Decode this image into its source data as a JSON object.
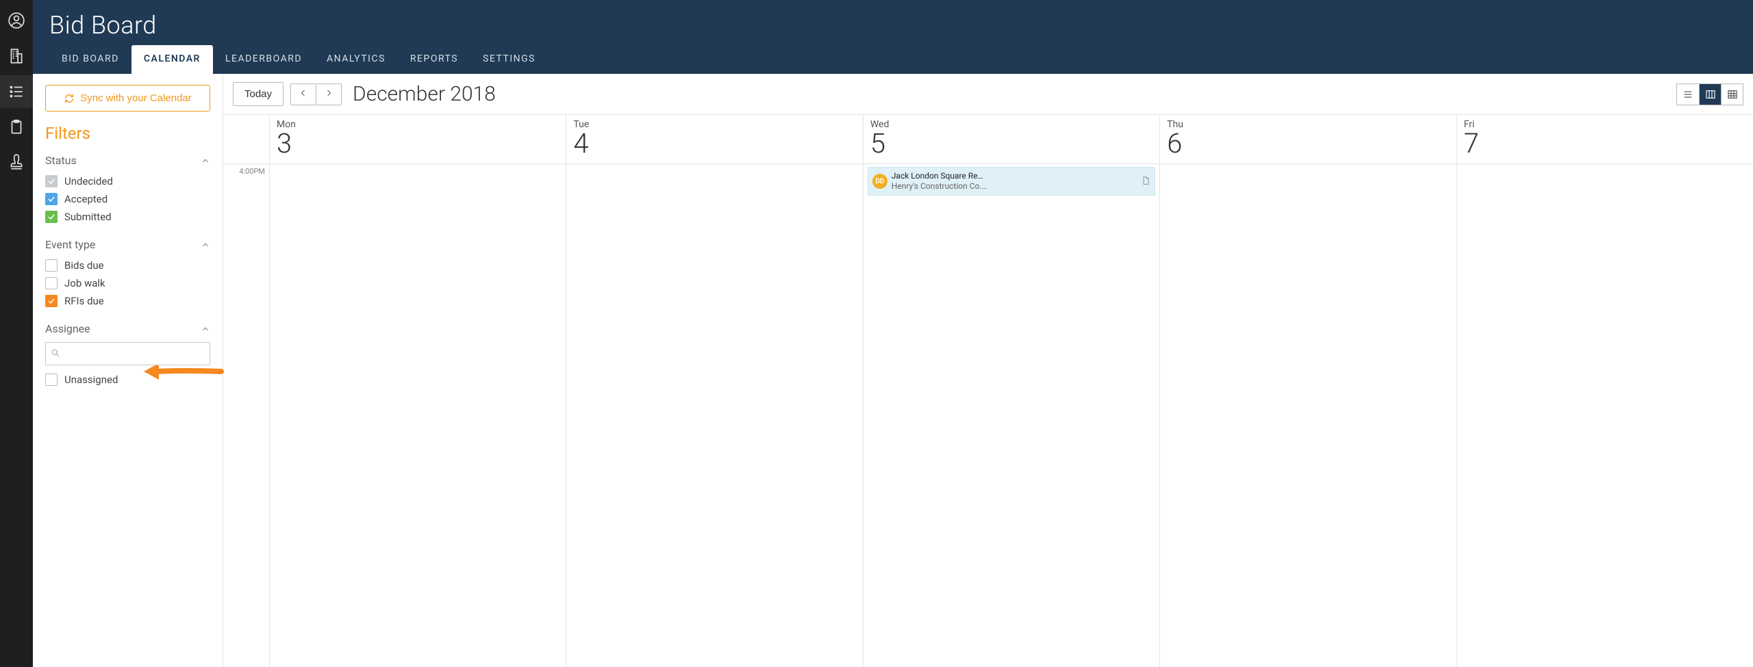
{
  "header": {
    "title": "Bid Board",
    "tabs": [
      {
        "label": "BID BOARD",
        "active": false
      },
      {
        "label": "CALENDAR",
        "active": true
      },
      {
        "label": "LEADERBOARD",
        "active": false
      },
      {
        "label": "ANALYTICS",
        "active": false
      },
      {
        "label": "REPORTS",
        "active": false
      },
      {
        "label": "SETTINGS",
        "active": false
      }
    ]
  },
  "sidebar": {
    "sync_label": "Sync with your Calendar",
    "filters_heading": "Filters",
    "groups": {
      "status": {
        "title": "Status",
        "items": [
          {
            "label": "Undecided",
            "checked": true,
            "style": "gray"
          },
          {
            "label": "Accepted",
            "checked": true,
            "style": "blue"
          },
          {
            "label": "Submitted",
            "checked": true,
            "style": "green"
          }
        ]
      },
      "event_type": {
        "title": "Event type",
        "items": [
          {
            "label": "Bids due",
            "checked": false,
            "style": ""
          },
          {
            "label": "Job walk",
            "checked": false,
            "style": ""
          },
          {
            "label": "RFIs due",
            "checked": true,
            "style": "orange"
          }
        ]
      },
      "assignee": {
        "title": "Assignee",
        "search_placeholder": "",
        "items": [
          {
            "label": "Unassigned",
            "checked": false,
            "style": ""
          }
        ]
      }
    }
  },
  "calendar": {
    "today_label": "Today",
    "month_title": "December 2018",
    "time_label": "4:00PM",
    "days": [
      {
        "dow": "Mon",
        "num": "3"
      },
      {
        "dow": "Tue",
        "num": "4"
      },
      {
        "dow": "Wed",
        "num": "5"
      },
      {
        "dow": "Thu",
        "num": "6"
      },
      {
        "dow": "Fri",
        "num": "7"
      }
    ],
    "event": {
      "avatar_initials": "DD",
      "line1": "Jack London Square Re…",
      "line2": "Henry's Construction Co.…"
    }
  }
}
